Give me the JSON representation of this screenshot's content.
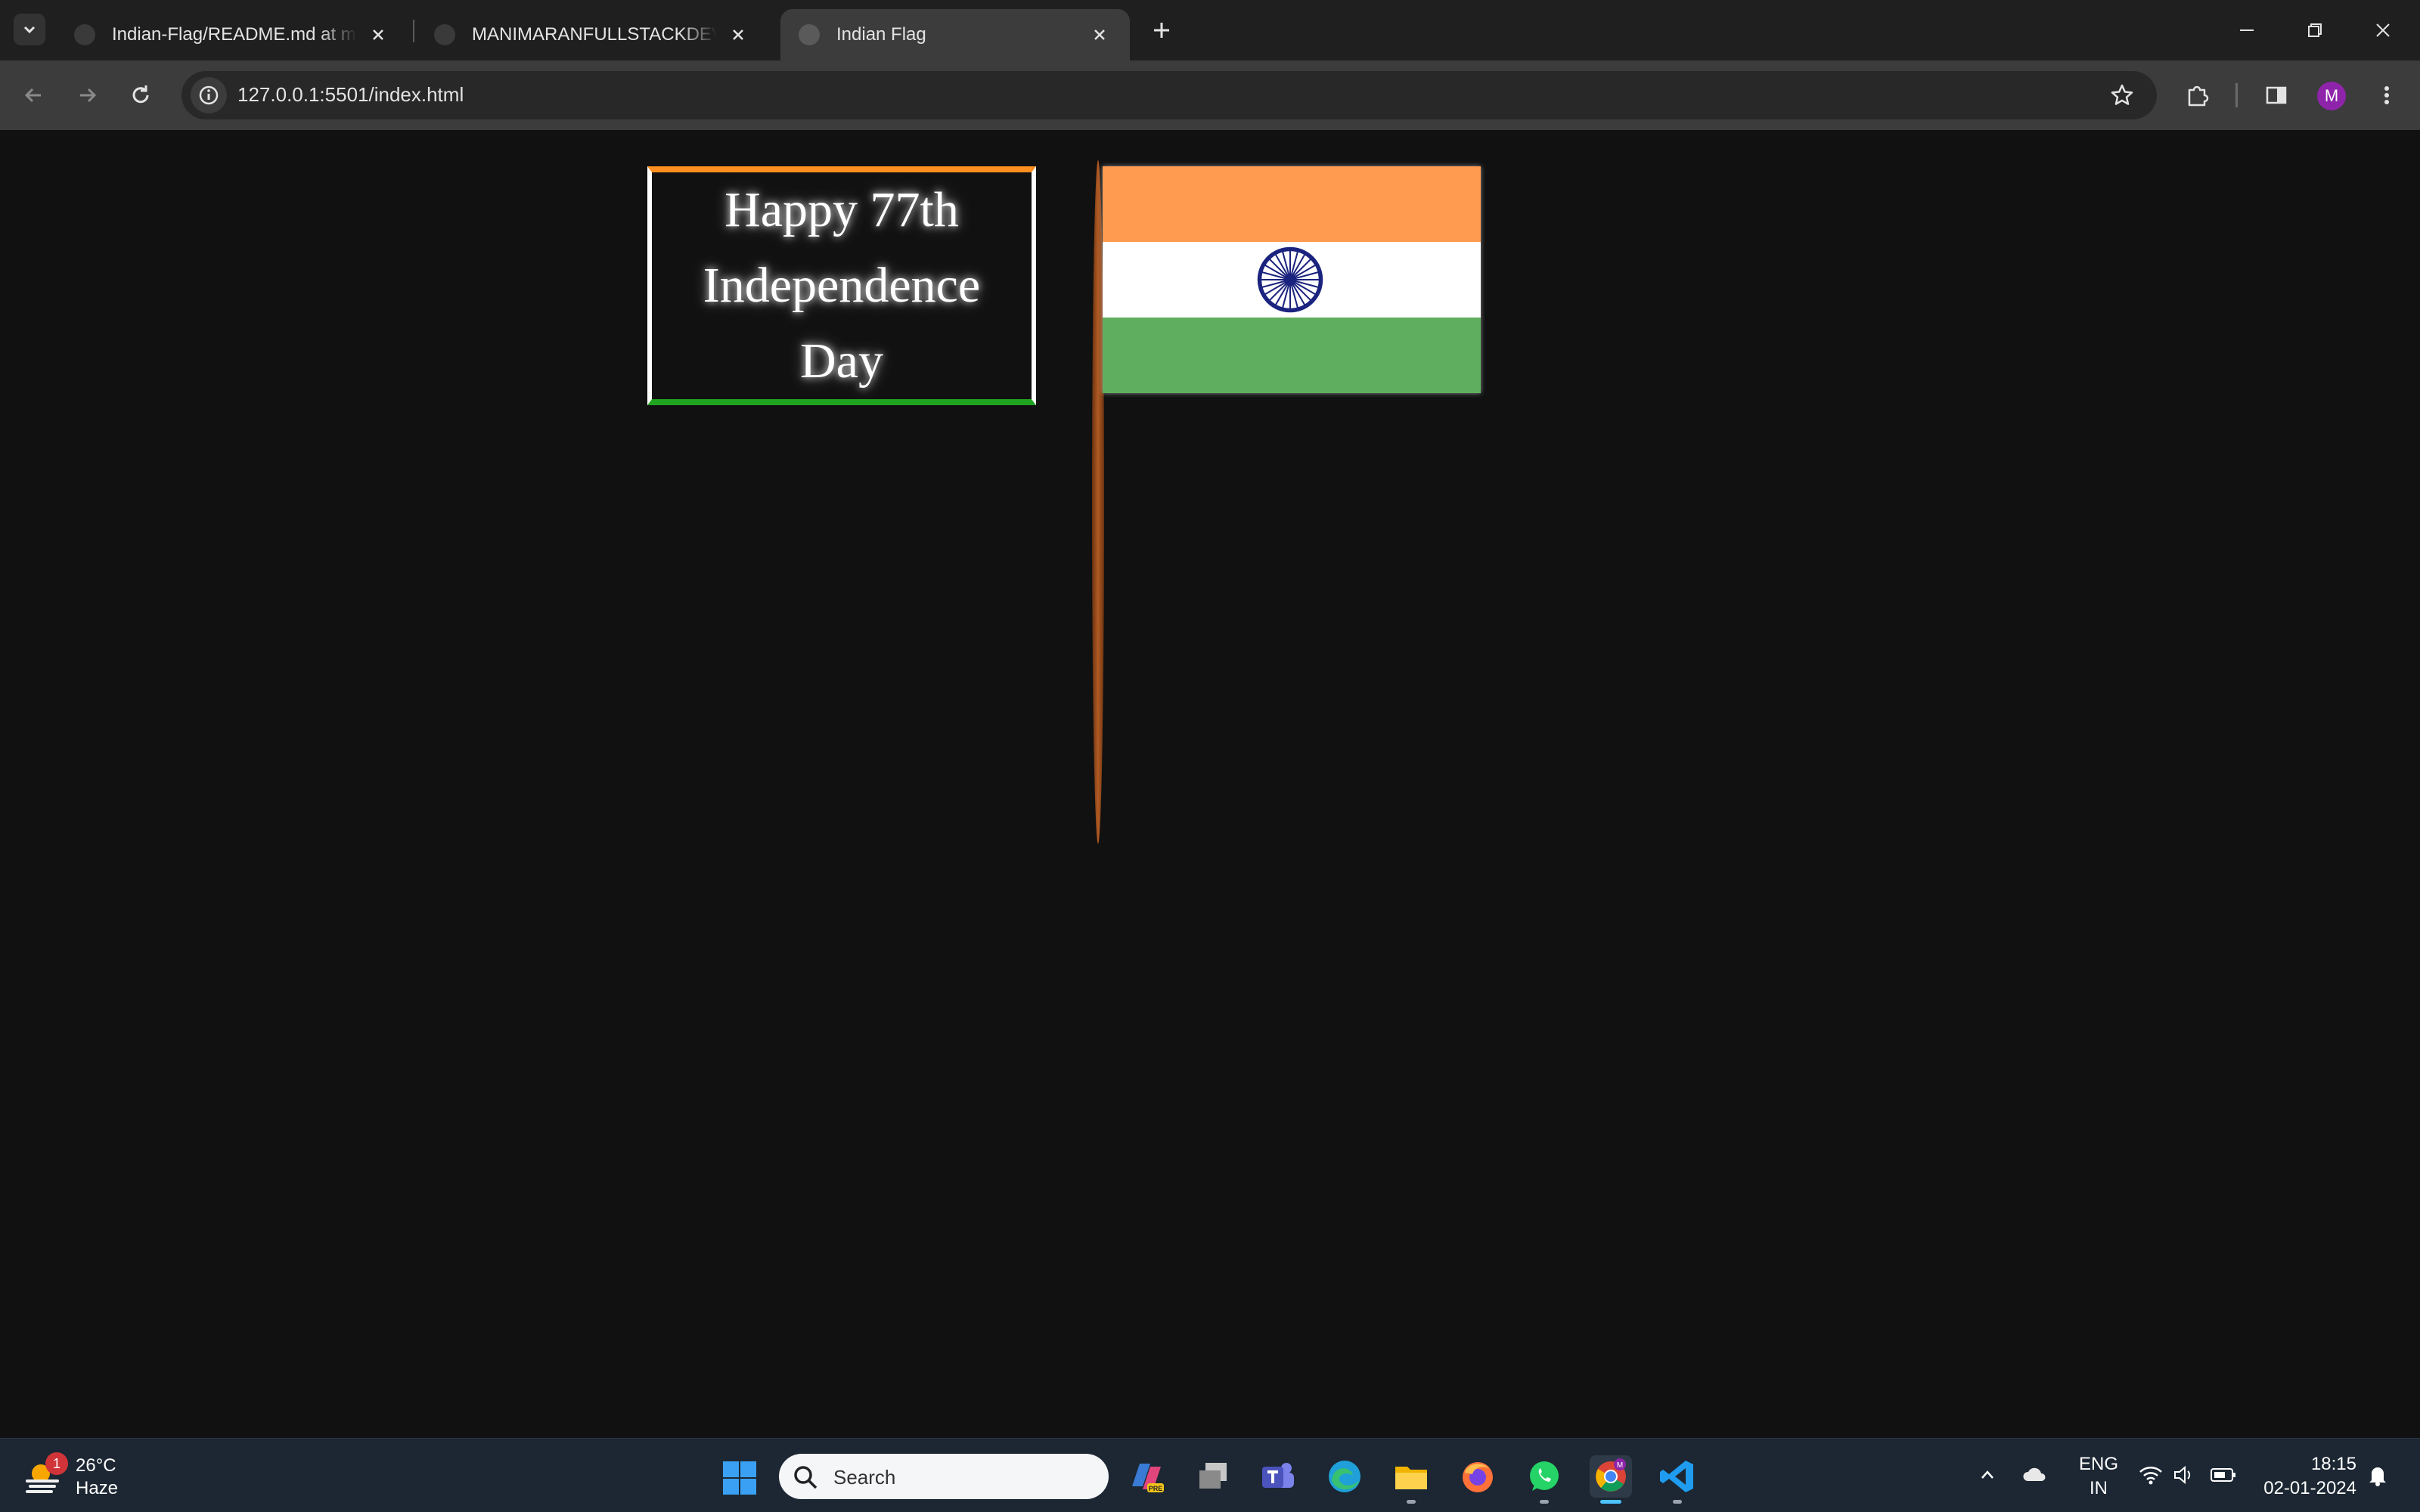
{
  "browser": {
    "tabs": [
      {
        "title": "Indian-Flag/README.md at main · MANIMARANFULLSTACKDEVELOPER/Indian-Flag",
        "active": false
      },
      {
        "title": "MANIMARANFULLSTACKDEVELOPER",
        "active": false
      },
      {
        "title": "Indian Flag",
        "active": true
      }
    ],
    "url": "127.0.0.1:5501/index.html",
    "profile_initial": "M"
  },
  "page": {
    "greeting_lines": [
      "Happy 77th",
      "Independence",
      "Day"
    ],
    "colors": {
      "background": "#111111",
      "saffron": "#ff9b50",
      "white": "#ffffff",
      "green": "#5fae60",
      "chakra_blue": "#1a237e",
      "pole": "#b05a23"
    }
  },
  "taskbar": {
    "weather": {
      "badge": "1",
      "temperature": "26°C",
      "condition": "Haze"
    },
    "search_placeholder": "Search",
    "apps": [
      "copilot-icon",
      "task-view-icon",
      "teams-icon",
      "edge-icon",
      "file-explorer-icon",
      "firefox-icon",
      "whatsapp-icon",
      "chrome-icon",
      "vscode-icon"
    ],
    "tray": {
      "language_line1": "ENG",
      "language_line2": "IN",
      "time": "18:15",
      "date": "02-01-2024"
    }
  }
}
